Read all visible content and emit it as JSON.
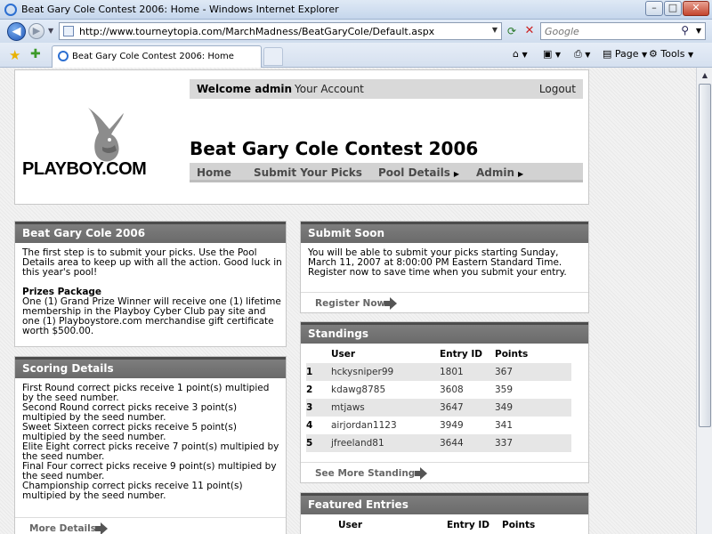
{
  "window": {
    "title": "Beat Gary Cole Contest 2006: Home - Windows Internet Explorer",
    "url": "http://www.tourneytopia.com/MarchMadness/BeatGaryCole/Default.aspx",
    "search_placeholder": "Google",
    "tab_title": "Beat Gary Cole Contest 2006: Home",
    "tools": {
      "page": "Page",
      "tools": "Tools"
    }
  },
  "site": {
    "logo": "PLAYBOY.COM",
    "welcome": "Welcome admin",
    "account": "Your Account",
    "logout": "Logout",
    "title": "Beat Gary Cole Contest 2006",
    "nav": [
      "Home",
      "Submit Your Picks",
      "Pool Details",
      "Admin"
    ]
  },
  "intro": {
    "heading": "Beat Gary Cole 2006",
    "text": "The first step is to submit your picks. Use the Pool Details area to keep up with all the action. Good luck in this year's pool!",
    "prizes_title": "Prizes Package",
    "prizes_text": "One (1) Grand Prize Winner will receive one (1) lifetime membership in the Playboy Cyber Club pay site and one (1) Playboystore.com merchandise gift certificate worth $500.00."
  },
  "scoring": {
    "heading": "Scoring Details",
    "lines": [
      "First Round correct picks receive 1 point(s) multipied by the seed number.",
      "Second Round correct picks receive 3 point(s) multipied by the seed number.",
      "Sweet Sixteen correct picks receive 5 point(s) multipied by the seed number.",
      "Elite Eight correct picks receive 7 point(s) multipied by the seed number.",
      "Final Four correct picks receive 9 point(s) multipied by the seed number.",
      "Championship correct picks receive 11 point(s) multipied by the seed number."
    ],
    "link": "More Details"
  },
  "submit": {
    "heading": "Submit Soon",
    "text": "You will be able to submit your picks starting Sunday, March 11, 2007 at 8:00:00 PM Eastern Standard Time. Register now to save time when you submit your entry.",
    "link": "Register Now"
  },
  "standings": {
    "heading": "Standings",
    "columns": [
      "User",
      "Entry ID",
      "Points"
    ],
    "rows": [
      {
        "rank": "1",
        "user": "hckysniper99",
        "entry": "1801",
        "points": "367"
      },
      {
        "rank": "2",
        "user": "kdawg8785",
        "entry": "3608",
        "points": "359"
      },
      {
        "rank": "3",
        "user": "mtjaws",
        "entry": "3647",
        "points": "349"
      },
      {
        "rank": "4",
        "user": "airjordan1123",
        "entry": "3949",
        "points": "341"
      },
      {
        "rank": "5",
        "user": "jfreeland81",
        "entry": "3644",
        "points": "337"
      }
    ],
    "link": "See More Standings"
  },
  "featured": {
    "heading": "Featured Entries",
    "columns": [
      "User",
      "Entry ID",
      "Points"
    ]
  }
}
